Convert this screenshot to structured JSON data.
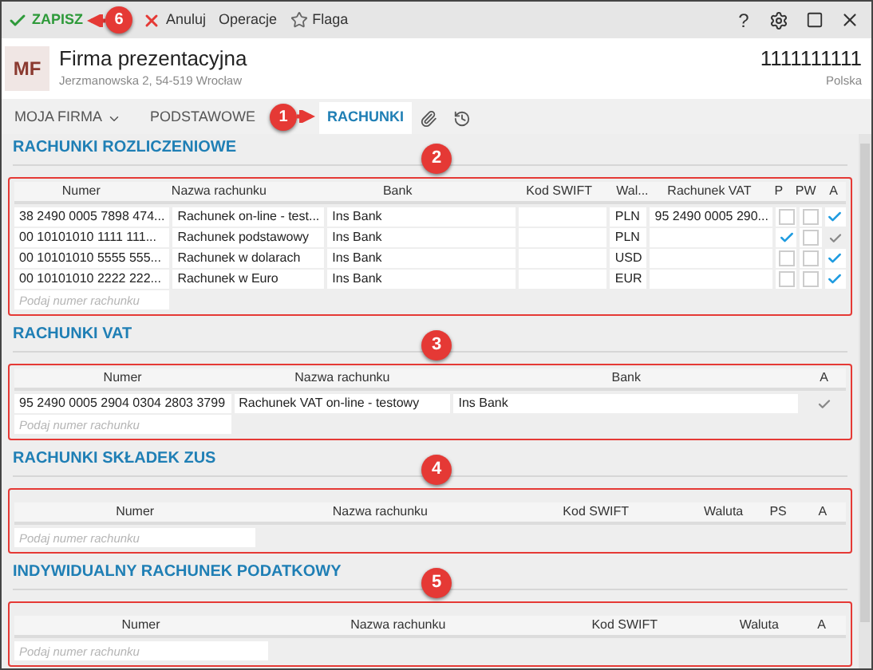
{
  "toolbar": {
    "actions": [
      {
        "label": "ZAPISZ",
        "kind": "save",
        "callout": "6"
      },
      {
        "label": "Anuluj",
        "kind": "cancel"
      },
      {
        "label": "Operacje",
        "kind": "plain"
      },
      {
        "label": "Flaga",
        "kind": "flag"
      }
    ],
    "window_controls": [
      {
        "kind": "help",
        "label": "?"
      },
      {
        "kind": "settings"
      },
      {
        "kind": "maximize"
      },
      {
        "kind": "close"
      }
    ]
  },
  "header": {
    "avatar": "MF",
    "name": "Firma prezentacyjna",
    "address": "Jerzmanowska 2, 54-519 Wrocław",
    "nip": "1111111111",
    "country": "Polska"
  },
  "tabs": [
    {
      "label": "MOJA FIRMA",
      "kind": "menu",
      "selected": false
    },
    {
      "label": "PODSTAWOWE",
      "kind": "text",
      "selected": false
    },
    {
      "label": "RACHUNKI",
      "kind": "text",
      "selected": true,
      "callout": "1"
    },
    {
      "kind": "attachment",
      "selected": false
    },
    {
      "kind": "history",
      "selected": false
    }
  ],
  "sections": [
    {
      "title": "RACHUNKI ROZLICZENIOWE",
      "callout": "2",
      "highlighted": true,
      "columns": [
        {
          "label": "Numer",
          "kind": "text"
        },
        {
          "label": "Nazwa rachunku",
          "kind": "text"
        },
        {
          "label": "Bank",
          "kind": "text"
        },
        {
          "label": "Kod SWIFT",
          "kind": "text"
        },
        {
          "label": "Wal...",
          "kind": "text"
        },
        {
          "label": "Rachunek VAT",
          "kind": "text"
        },
        {
          "label": "P",
          "kind": "check"
        },
        {
          "label": "PW",
          "kind": "check"
        },
        {
          "label": "A",
          "kind": "check"
        }
      ],
      "rows": [
        {
          "cells": [
            "38 2490 0005 7898 474...",
            "Rachunek on-line - test...",
            "Ins Bank",
            null,
            "PLN",
            "95 2490 0005 290...",
            {
              "checked": false,
              "disabled": false
            },
            {
              "checked": false,
              "disabled": false
            },
            {
              "checked": true,
              "disabled": false
            }
          ]
        },
        {
          "cells": [
            "00 10101010 1111 111...",
            "Rachunek podstawowy",
            "Ins Bank",
            null,
            "PLN",
            null,
            {
              "checked": true,
              "disabled": false
            },
            {
              "checked": false,
              "disabled": false
            },
            {
              "checked": true,
              "disabled": true
            }
          ]
        },
        {
          "cells": [
            "00 10101010 5555 555...",
            "Rachunek w dolarach",
            "Ins Bank",
            null,
            "USD",
            null,
            {
              "checked": false,
              "disabled": false
            },
            {
              "checked": false,
              "disabled": false
            },
            {
              "checked": true,
              "disabled": false
            }
          ]
        },
        {
          "cells": [
            "00 10101010 2222 222...",
            "Rachunek w Euro",
            "Ins Bank",
            null,
            "EUR",
            null,
            {
              "checked": false,
              "disabled": false
            },
            {
              "checked": false,
              "disabled": false
            },
            {
              "checked": true,
              "disabled": false
            }
          ]
        }
      ],
      "placeholder": "Podaj numer rachunku"
    },
    {
      "title": "RACHUNKI VAT",
      "callout": "3",
      "highlighted": true,
      "columns": [
        {
          "label": "Numer",
          "kind": "text"
        },
        {
          "label": "Nazwa rachunku",
          "kind": "text"
        },
        {
          "label": "Bank",
          "kind": "text"
        },
        {
          "label": "A",
          "kind": "check"
        }
      ],
      "rows": [
        {
          "cells": [
            "95 2490 0005 2904 0304 2803 3799",
            "Rachunek VAT on-line - testowy",
            "Ins Bank",
            {
              "checked": true,
              "disabled": true
            }
          ]
        }
      ],
      "placeholder": "Podaj numer rachunku"
    },
    {
      "title": "RACHUNKI SKŁADEK ZUS",
      "callout": "4",
      "highlighted": true,
      "columns": [
        {
          "label": "Numer",
          "kind": "text"
        },
        {
          "label": "Nazwa rachunku",
          "kind": "text"
        },
        {
          "label": "Kod SWIFT",
          "kind": "text"
        },
        {
          "label": "Waluta",
          "kind": "text"
        },
        {
          "label": "PS",
          "kind": "check"
        },
        {
          "label": "A",
          "kind": "check"
        }
      ],
      "placeholder": "Podaj numer rachunku"
    },
    {
      "title": "INDYWIDUALNY RACHUNEK PODATKOWY",
      "callout": "5",
      "highlighted": true,
      "columns": [
        {
          "label": "Numer",
          "kind": "text"
        },
        {
          "label": "Nazwa rachunku",
          "kind": "text"
        },
        {
          "label": "Kod SWIFT",
          "kind": "text"
        },
        {
          "label": "Waluta",
          "kind": "text"
        },
        {
          "label": "A",
          "kind": "check"
        }
      ],
      "placeholder": "Podaj numer rachunku"
    }
  ]
}
